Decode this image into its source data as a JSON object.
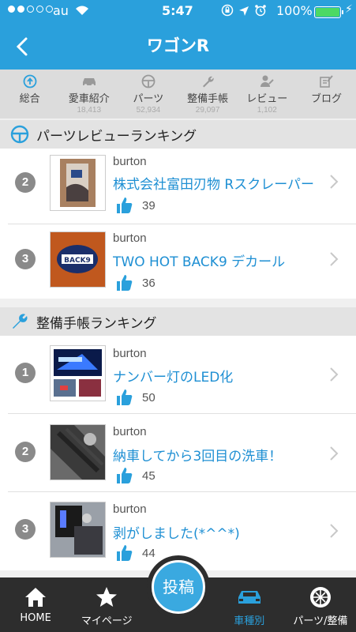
{
  "status": {
    "carrier": "au",
    "time": "5:47",
    "battery": "100%"
  },
  "header": {
    "title": "ワゴンR"
  },
  "tabs": [
    {
      "label": "総合",
      "count": ""
    },
    {
      "label": "愛車紹介",
      "count": "18,413"
    },
    {
      "label": "パーツ",
      "count": "52,934"
    },
    {
      "label": "整備手帳",
      "count": "29,097"
    },
    {
      "label": "レビュー",
      "count": "1,102"
    },
    {
      "label": "ブログ",
      "count": ""
    }
  ],
  "parts_section": {
    "title": "パーツレビューランキング",
    "items": [
      {
        "rank": "2",
        "user": "burton",
        "title": "株式会社富田刃物 Rスクレーパー",
        "likes": "39"
      },
      {
        "rank": "3",
        "user": "burton",
        "title": "TWO HOT BACK9 デカール",
        "likes": "36"
      }
    ]
  },
  "maint_section": {
    "title": "整備手帳ランキング",
    "items": [
      {
        "rank": "1",
        "user": "burton",
        "title": "ナンバー灯のLED化",
        "likes": "50"
      },
      {
        "rank": "2",
        "user": "burton",
        "title": "納車してから3回目の洗車！",
        "likes": "45"
      },
      {
        "rank": "3",
        "user": "burton",
        "title": "剥がしました(*^^*)",
        "likes": "44"
      }
    ]
  },
  "bottom_nav": {
    "home": "HOME",
    "mypage": "マイページ",
    "post": "投稿",
    "car_type": "車種別",
    "parts": "パーツ/整備"
  },
  "colors": {
    "accent": "#2aa0dc",
    "link": "#1e8fd3",
    "nav_bg": "#2d2d2d"
  }
}
